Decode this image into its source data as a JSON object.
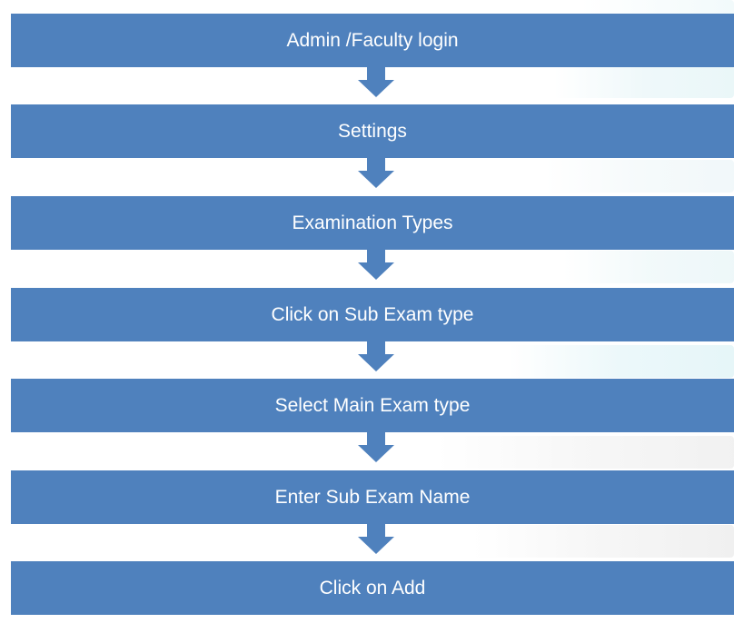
{
  "flow": {
    "steps": [
      "Admin /Faculty login",
      "Settings",
      "Examination Types",
      "Click on Sub Exam type",
      "Select Main Exam type",
      "Enter Sub Exam Name",
      "Click on Add"
    ]
  },
  "colors": {
    "box_fill": "#4f81bd",
    "arrow_fill": "#4f81bd",
    "text": "#ffffff",
    "background": "#ffffff"
  }
}
